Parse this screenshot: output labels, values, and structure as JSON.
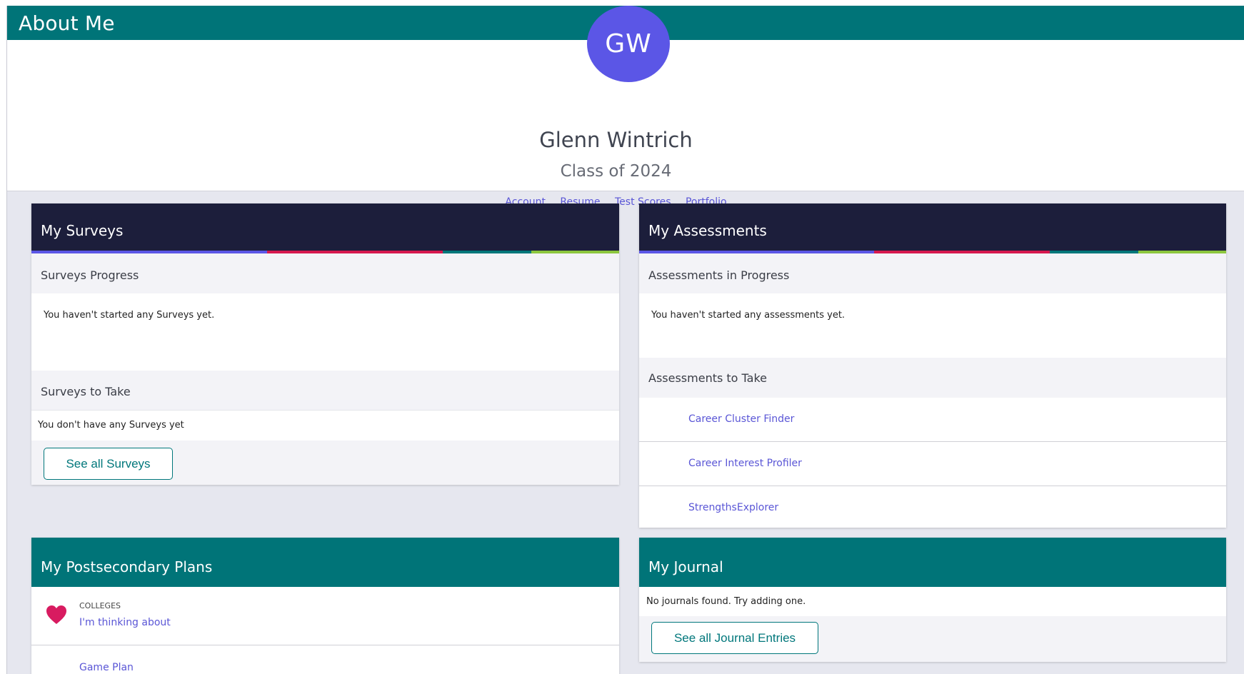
{
  "header": {
    "title": "About Me"
  },
  "profile": {
    "initials": "GW",
    "name": "Glenn Wintrich",
    "class_label": "Class of 2024",
    "avatar_color": "#5b56e6",
    "links": [
      "Account",
      "Resume",
      "Test Scores",
      "Portfolio"
    ]
  },
  "colors": {
    "teal": "#007478",
    "navy": "#1c1e3b",
    "link": "#5a56d6",
    "stripe": [
      "#5b56e6",
      "#d6184f",
      "#00777b",
      "#8cc63f"
    ],
    "heart": "#d81b60"
  },
  "surveys": {
    "title": "My Surveys",
    "progress_label": "Surveys Progress",
    "progress_empty": "You haven't started any Surveys yet.",
    "to_take_label": "Surveys to Take",
    "to_take_empty": "You don't have any Surveys yet",
    "see_all": "See all Surveys"
  },
  "assessments": {
    "title": "My Assessments",
    "progress_label": "Assessments in Progress",
    "progress_empty": "You haven't started any assessments yet.",
    "to_take_label": "Assessments to Take",
    "items": [
      "Career Cluster Finder",
      "Career Interest Profiler",
      "StrengthsExplorer"
    ]
  },
  "plans": {
    "title": "My Postsecondary Plans",
    "colleges_label": "COLLEGES",
    "colleges_link": "I'm thinking about",
    "game_plan": "Game Plan",
    "heart_icon": "heart-icon"
  },
  "journal": {
    "title": "My Journal",
    "empty": "No journals found. Try adding one.",
    "see_all": "See all Journal Entries"
  }
}
